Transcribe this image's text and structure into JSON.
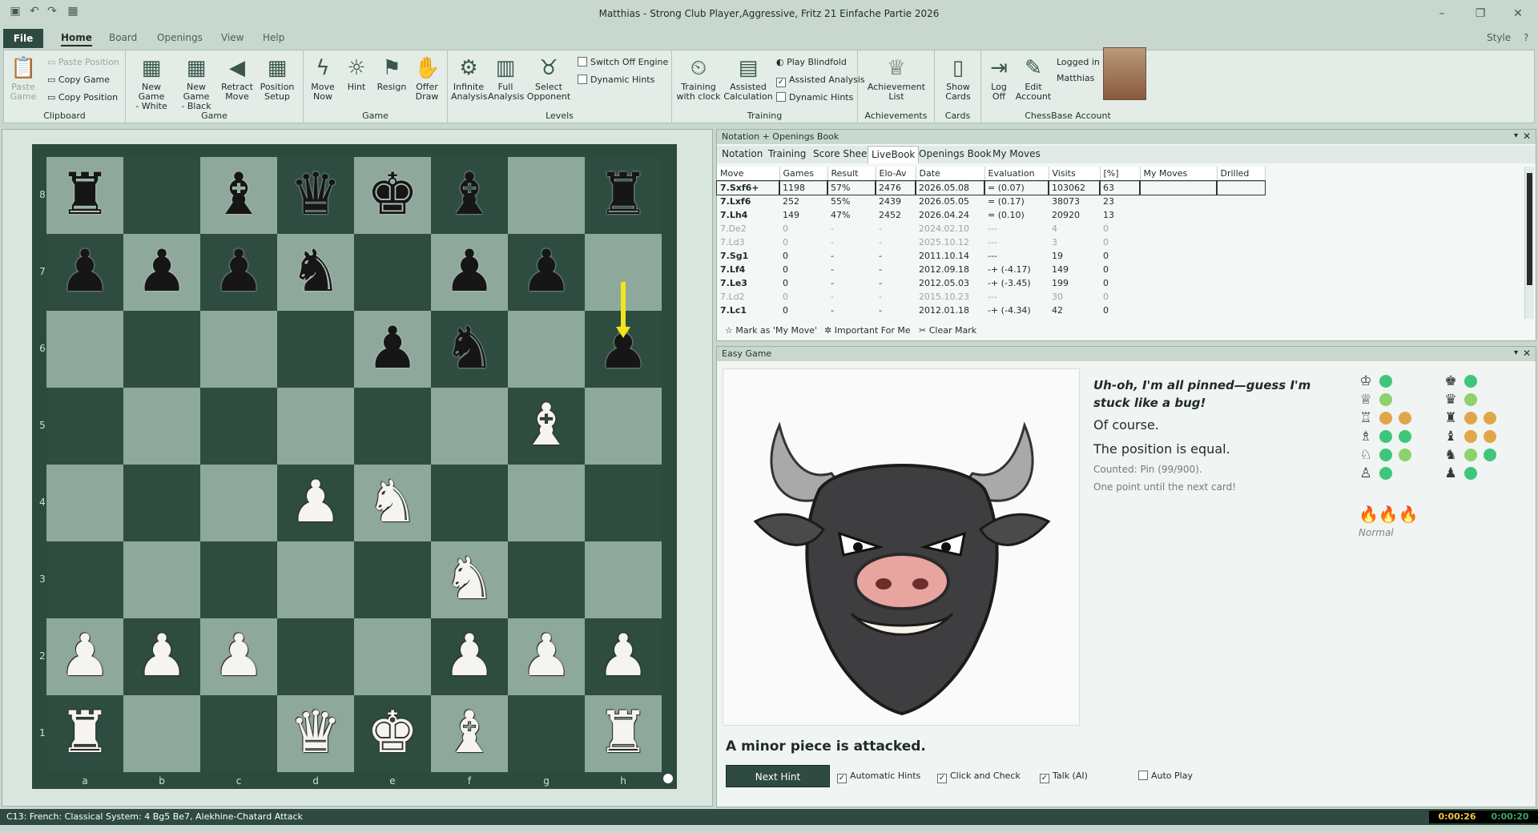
{
  "window": {
    "title": "Matthias - Strong Club Player,Aggressive, Fritz 21 Einfache Partie 2026",
    "style_label": "Style"
  },
  "menu": {
    "file": "File",
    "tabs": [
      "Home",
      "Board",
      "Openings",
      "View",
      "Help"
    ]
  },
  "ribbon": {
    "clipboard": {
      "label": "Clipboard",
      "paste_game": "Paste\nGame",
      "paste_position": "Paste Position",
      "copy_game": "Copy Game",
      "copy_position": "Copy Position"
    },
    "game": {
      "label": "Game",
      "new_white": "New Game\n- White",
      "new_black": "New Game\n- Black",
      "retract": "Retract\nMove",
      "setup": "Position\nSetup"
    },
    "game2": {
      "label": "Game",
      "move_now": "Move\nNow",
      "hint": "Hint",
      "resign": "Resign",
      "offer_draw": "Offer\nDraw"
    },
    "levels": {
      "label": "Levels",
      "infinite": "Infinite\nAnalysis",
      "full": "Full\nAnalysis",
      "select_opponent": "Select\nOpponent",
      "switch_off_engine": "Switch Off Engine",
      "dynamic_hints": "Dynamic Hints"
    },
    "training": {
      "label": "Training",
      "with_clock": "Training\nwith clock",
      "assisted_calc": "Assisted\nCalculation",
      "play_blindfold": "Play Blindfold",
      "assisted_analysis": "Assisted Analysis",
      "dynamic_hints": "Dynamic Hints"
    },
    "achievements": {
      "label": "Achievements",
      "list": "Achievement\nList"
    },
    "cards": {
      "label": "Cards",
      "show": "Show\nCards"
    },
    "account": {
      "label": "ChessBase Account",
      "logoff": "Log\nOff",
      "edit": "Edit\nAccount",
      "logged_in": "Logged in",
      "user": "Matthias"
    }
  },
  "board": {
    "ranks": [
      "8",
      "7",
      "6",
      "5",
      "4",
      "3",
      "2",
      "1"
    ],
    "files": [
      "a",
      "b",
      "c",
      "d",
      "e",
      "f",
      "g",
      "h"
    ],
    "pieces": [
      {
        "sq": "a8",
        "p": "♜",
        "c": "b"
      },
      {
        "sq": "c8",
        "p": "♝",
        "c": "b"
      },
      {
        "sq": "d8",
        "p": "♛",
        "c": "b"
      },
      {
        "sq": "e8",
        "p": "♚",
        "c": "b"
      },
      {
        "sq": "f8",
        "p": "♝",
        "c": "b"
      },
      {
        "sq": "h8",
        "p": "♜",
        "c": "b"
      },
      {
        "sq": "a7",
        "p": "♟",
        "c": "b"
      },
      {
        "sq": "b7",
        "p": "♟",
        "c": "b"
      },
      {
        "sq": "c7",
        "p": "♟",
        "c": "b"
      },
      {
        "sq": "d7",
        "p": "♞",
        "c": "b"
      },
      {
        "sq": "f7",
        "p": "♟",
        "c": "b"
      },
      {
        "sq": "g7",
        "p": "♟",
        "c": "b"
      },
      {
        "sq": "e6",
        "p": "♟",
        "c": "b"
      },
      {
        "sq": "f6",
        "p": "♞",
        "c": "b"
      },
      {
        "sq": "h6",
        "p": "♟",
        "c": "b"
      },
      {
        "sq": "g5",
        "p": "♝",
        "c": "w"
      },
      {
        "sq": "d4",
        "p": "♟",
        "c": "w"
      },
      {
        "sq": "e4",
        "p": "♞",
        "c": "w"
      },
      {
        "sq": "f3",
        "p": "♞",
        "c": "w"
      },
      {
        "sq": "a2",
        "p": "♟",
        "c": "w"
      },
      {
        "sq": "b2",
        "p": "♟",
        "c": "w"
      },
      {
        "sq": "c2",
        "p": "♟",
        "c": "w"
      },
      {
        "sq": "f2",
        "p": "♟",
        "c": "w"
      },
      {
        "sq": "g2",
        "p": "♟",
        "c": "w"
      },
      {
        "sq": "h2",
        "p": "♟",
        "c": "w"
      },
      {
        "sq": "a1",
        "p": "♜",
        "c": "w"
      },
      {
        "sq": "d1",
        "p": "♛",
        "c": "w"
      },
      {
        "sq": "e1",
        "p": "♚",
        "c": "w"
      },
      {
        "sq": "f1",
        "p": "♝",
        "c": "w"
      },
      {
        "sq": "h1",
        "p": "♜",
        "c": "w"
      }
    ],
    "arrow": {
      "from": "h7",
      "to": "h6",
      "color": "#f2e51c"
    }
  },
  "notation": {
    "panel_title": "Notation + Openings Book",
    "tabs": [
      "Notation",
      "Training",
      "Score Sheet",
      "LiveBook",
      "Openings Book",
      "My Moves"
    ],
    "active_tab": "LiveBook",
    "columns": [
      "Move",
      "Games",
      "Result",
      "Elo-Av",
      "Date",
      "Evaluation",
      "Visits",
      "[%]",
      "My Moves",
      "Drilled"
    ],
    "rows": [
      [
        "7.Sxf6+",
        "1198",
        "57%",
        "2476",
        "2026.05.08",
        "= (0.07)",
        "103062",
        "63",
        "",
        ""
      ],
      [
        "7.Lxf6",
        "252",
        "55%",
        "2439",
        "2026.05.05",
        "= (0.17)",
        "38073",
        "23",
        "",
        ""
      ],
      [
        "7.Lh4",
        "149",
        "47%",
        "2452",
        "2026.04.24",
        "= (0.10)",
        "20920",
        "13",
        "",
        ""
      ],
      [
        "7.De2",
        "0",
        "-",
        "-",
        "2024.02.10",
        "---",
        "4",
        "0",
        "",
        ""
      ],
      [
        "7.Ld3",
        "0",
        "-",
        "-",
        "2025.10.12",
        "---",
        "3",
        "0",
        "",
        ""
      ],
      [
        "7.Sg1",
        "0",
        "-",
        "-",
        "2011.10.14",
        "---",
        "19",
        "0",
        "",
        ""
      ],
      [
        "7.Lf4",
        "0",
        "-",
        "-",
        "2012.09.18",
        "-+ (-4.17)",
        "149",
        "0",
        "",
        ""
      ],
      [
        "7.Le3",
        "0",
        "-",
        "-",
        "2012.05.03",
        "-+ (-3.45)",
        "199",
        "0",
        "",
        ""
      ],
      [
        "7.Ld2",
        "0",
        "-",
        "-",
        "2015.10.23",
        "---",
        "30",
        "0",
        "",
        ""
      ],
      [
        "7.Lc1",
        "0",
        "-",
        "-",
        "2012.01.18",
        "-+ (-4.34)",
        "42",
        "0",
        "",
        ""
      ]
    ],
    "grey_rows": [
      3,
      4,
      8
    ],
    "actions": {
      "mark": "Mark as 'My Move'",
      "important": "Important For Me",
      "clear": "Clear Mark"
    }
  },
  "easygame": {
    "panel_title": "Easy Game",
    "speech": "Uh-oh, I'm all pinned—guess I'm stuck like a bug!",
    "reply": "Of course.",
    "assessment": "The position is equal.",
    "counted": "Counted: Pin (99/900).",
    "next_card": "One point until the next card!",
    "level": "Normal",
    "hint_text": "A minor piece is attacked.",
    "next_hint": "Next Hint",
    "options": {
      "automatic_hints": "Automatic Hints",
      "click_check": "Click and Check",
      "talk": "Talk (AI)",
      "auto_play": "Auto Play"
    }
  },
  "status": {
    "opening": "C13: French: Classical System: 4 Bg5 Be7, Alekhine-Chatard Attack",
    "clock_white": "0:00:26",
    "clock_black": "0:00:20"
  }
}
